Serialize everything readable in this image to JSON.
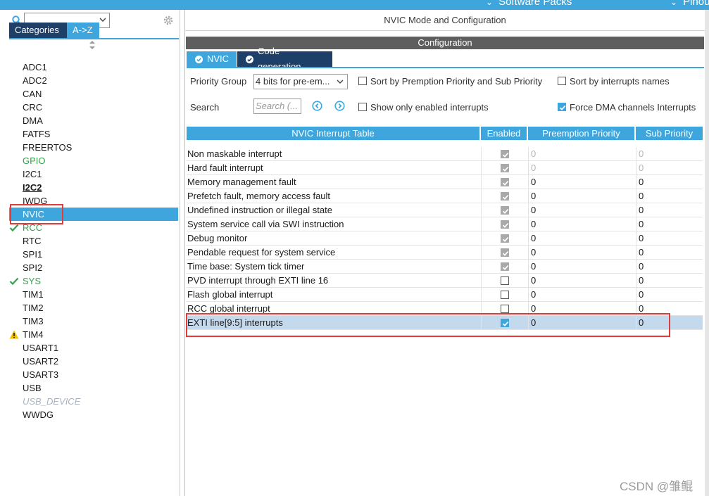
{
  "topbar": {
    "menus": [
      "Software Packs",
      "Pinout"
    ]
  },
  "left": {
    "search": {
      "value": ""
    },
    "tabs": [
      "Categories",
      "A->Z"
    ],
    "items": [
      {
        "label": "ADC1",
        "state": "normal"
      },
      {
        "label": "ADC2",
        "state": "normal"
      },
      {
        "label": "CAN",
        "state": "normal"
      },
      {
        "label": "CRC",
        "state": "normal"
      },
      {
        "label": "DMA",
        "state": "normal"
      },
      {
        "label": "FATFS",
        "state": "normal"
      },
      {
        "label": "FREERTOS",
        "state": "normal"
      },
      {
        "label": "GPIO",
        "state": "green"
      },
      {
        "label": "I2C1",
        "state": "normal"
      },
      {
        "label": "I2C2",
        "state": "bold"
      },
      {
        "label": "IWDG",
        "state": "normal"
      },
      {
        "label": "NVIC",
        "state": "selected"
      },
      {
        "label": "RCC",
        "state": "check"
      },
      {
        "label": "RTC",
        "state": "normal"
      },
      {
        "label": "SPI1",
        "state": "normal"
      },
      {
        "label": "SPI2",
        "state": "normal"
      },
      {
        "label": "SYS",
        "state": "check"
      },
      {
        "label": "TIM1",
        "state": "normal"
      },
      {
        "label": "TIM2",
        "state": "normal"
      },
      {
        "label": "TIM3",
        "state": "normal"
      },
      {
        "label": "TIM4",
        "state": "warning"
      },
      {
        "label": "USART1",
        "state": "normal"
      },
      {
        "label": "USART2",
        "state": "normal"
      },
      {
        "label": "USART3",
        "state": "normal"
      },
      {
        "label": "USB",
        "state": "normal"
      },
      {
        "label": "USB_DEVICE",
        "state": "disabled"
      },
      {
        "label": "WWDG",
        "state": "normal"
      }
    ]
  },
  "main": {
    "mode_title": "NVIC Mode and Configuration",
    "config_title": "Configuration",
    "tabs": [
      "NVIC",
      "Code generation"
    ],
    "priority_group_label": "Priority Group",
    "priority_group_value": "4 bits for pre-em...",
    "search_label": "Search",
    "search_placeholder": "Search (...",
    "options": {
      "sort_premption": "Sort by Premption Priority and Sub Priority",
      "sort_names": "Sort by interrupts names",
      "show_enabled": "Show only enabled interrupts",
      "force_dma": "Force DMA channels Interrupts"
    },
    "option_states": {
      "sort_premption": false,
      "sort_names": false,
      "show_enabled": false,
      "force_dma": true
    },
    "table": {
      "headers": [
        "NVIC Interrupt Table",
        "Enabled",
        "Preemption Priority",
        "Sub Priority"
      ],
      "rows": [
        {
          "name": "Non maskable interrupt",
          "enabled": "locked",
          "preemption": "0",
          "sub": "0",
          "dim": true
        },
        {
          "name": "Hard fault interrupt",
          "enabled": "locked",
          "preemption": "0",
          "sub": "0",
          "dim": true
        },
        {
          "name": "Memory management fault",
          "enabled": "locked",
          "preemption": "0",
          "sub": "0",
          "dim": false
        },
        {
          "name": "Prefetch fault, memory access fault",
          "enabled": "locked",
          "preemption": "0",
          "sub": "0",
          "dim": false
        },
        {
          "name": "Undefined instruction or illegal state",
          "enabled": "locked",
          "preemption": "0",
          "sub": "0",
          "dim": false
        },
        {
          "name": "System service call via SWI instruction",
          "enabled": "locked",
          "preemption": "0",
          "sub": "0",
          "dim": false
        },
        {
          "name": "Debug monitor",
          "enabled": "locked",
          "preemption": "0",
          "sub": "0",
          "dim": false
        },
        {
          "name": "Pendable request for system service",
          "enabled": "locked",
          "preemption": "0",
          "sub": "0",
          "dim": false
        },
        {
          "name": "Time base: System tick timer",
          "enabled": "locked",
          "preemption": "0",
          "sub": "0",
          "dim": false
        },
        {
          "name": "PVD interrupt through EXTI line 16",
          "enabled": "off",
          "preemption": "0",
          "sub": "0",
          "dim": false
        },
        {
          "name": "Flash global interrupt",
          "enabled": "off",
          "preemption": "0",
          "sub": "0",
          "dim": false
        },
        {
          "name": "RCC global interrupt",
          "enabled": "off",
          "preemption": "0",
          "sub": "0",
          "dim": false
        },
        {
          "name": "EXTI line[9:5] interrupts",
          "enabled": "on",
          "preemption": "0",
          "sub": "0",
          "dim": false,
          "selected": true
        }
      ]
    }
  },
  "watermark": "CSDN @雏鲲",
  "colors": {
    "accent": "#3ea6dc",
    "navy": "#1e3f68",
    "highlight": "#e23b3b",
    "green": "#33a24a",
    "warning": "#f2c300"
  }
}
